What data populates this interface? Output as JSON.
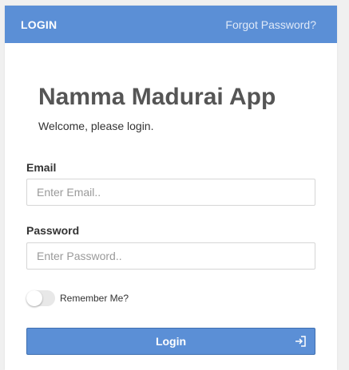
{
  "header": {
    "title": "LOGIN",
    "forgot_link": "Forgot Password?"
  },
  "app": {
    "title": "Namma Madurai App",
    "welcome": "Welcome, please login."
  },
  "form": {
    "email": {
      "label": "Email",
      "placeholder": "Enter Email..",
      "value": ""
    },
    "password": {
      "label": "Password",
      "placeholder": "Enter Password..",
      "value": ""
    },
    "remember_me": {
      "label": "Remember Me?",
      "checked": false
    },
    "submit_label": "Login",
    "submit_icon": "login-icon"
  },
  "colors": {
    "accent": "#5b8fd6",
    "accent_border": "#3f6fb0",
    "page_bg": "#f0f0f0"
  }
}
